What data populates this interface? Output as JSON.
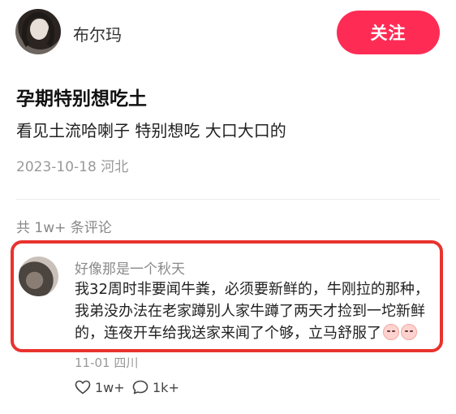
{
  "header": {
    "author_name": "布尔玛",
    "follow_label": "关注"
  },
  "post": {
    "title": "孕期特别想吃土",
    "body": "看见土流哈喇子 特别想吃 大口大口的",
    "meta": "2023-10-18 河北"
  },
  "comments": {
    "count_label": "共 1w+ 条评论",
    "top": {
      "author": "好像那是一个秋天",
      "text": "我32周时非要闻牛粪，必须要新鲜的，牛刚拉的那种，我弟没办法在老家蹲别人家牛蹲了两天才捡到一坨新鲜的，连夜开车给我送家来闻了个够，立马舒服了",
      "emojis": [
        "crying-face-icon",
        "crying-face-icon"
      ],
      "meta": "11-01 四川",
      "likes": "1w+",
      "replies": "1k+"
    }
  },
  "colors": {
    "accent": "#fe2c55",
    "highlight_border": "#e8332e"
  }
}
